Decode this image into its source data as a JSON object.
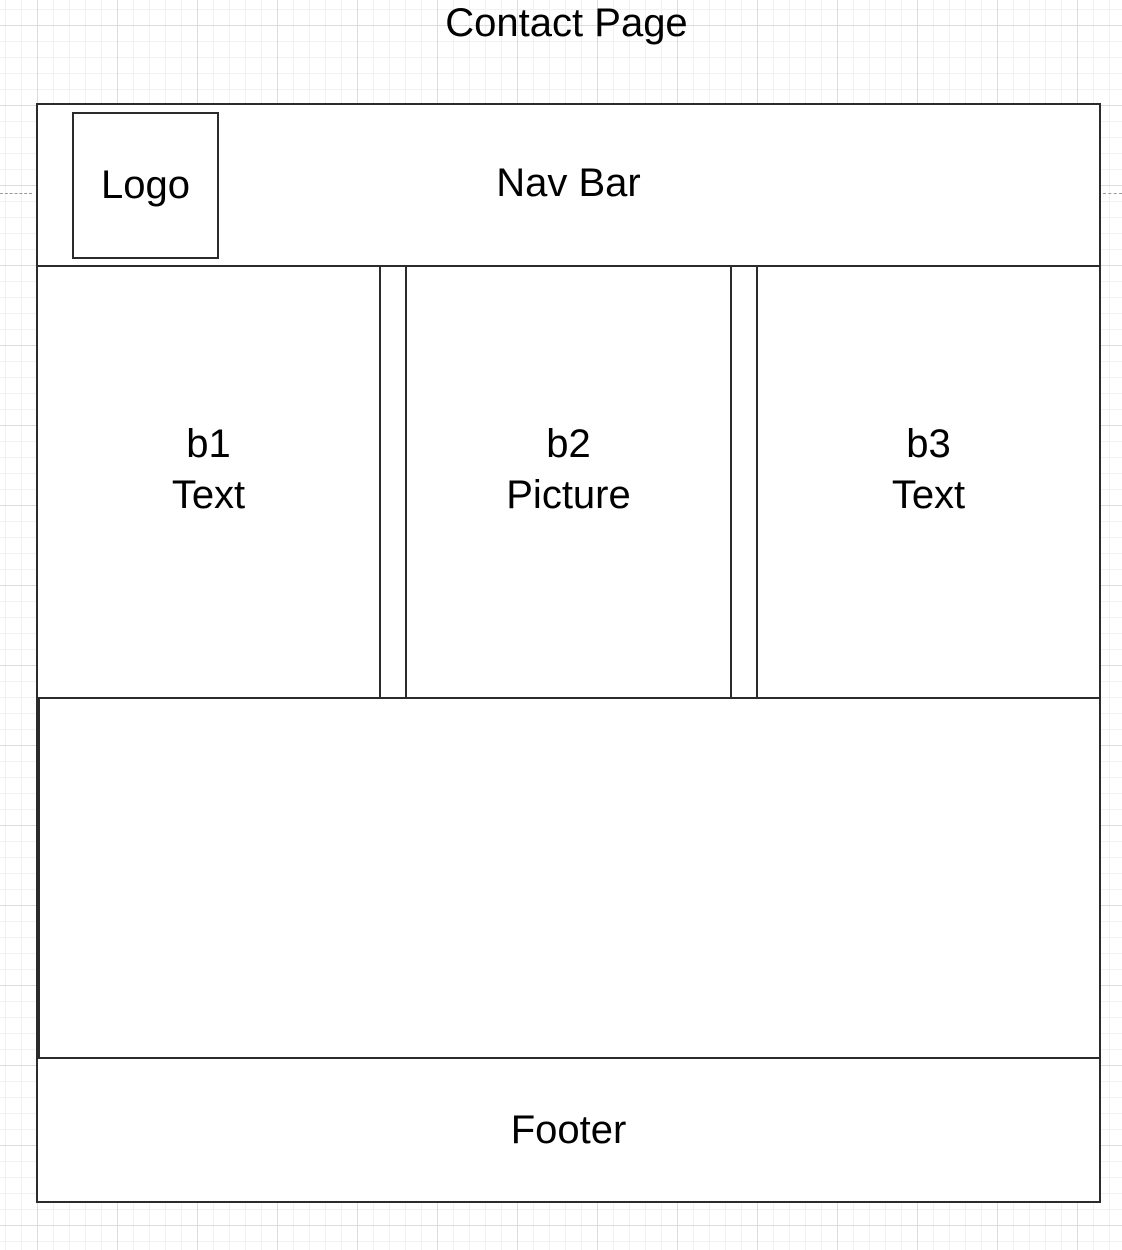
{
  "title": "Contact Page",
  "nav": {
    "label": "Nav Bar",
    "logo": "Logo"
  },
  "blocks": [
    {
      "id": "b1",
      "content": "Text"
    },
    {
      "id": "b2",
      "content": "Picture"
    },
    {
      "id": "b3",
      "content": "Text"
    }
  ],
  "content_area": {
    "label": ""
  },
  "footer": {
    "label": "Footer"
  }
}
